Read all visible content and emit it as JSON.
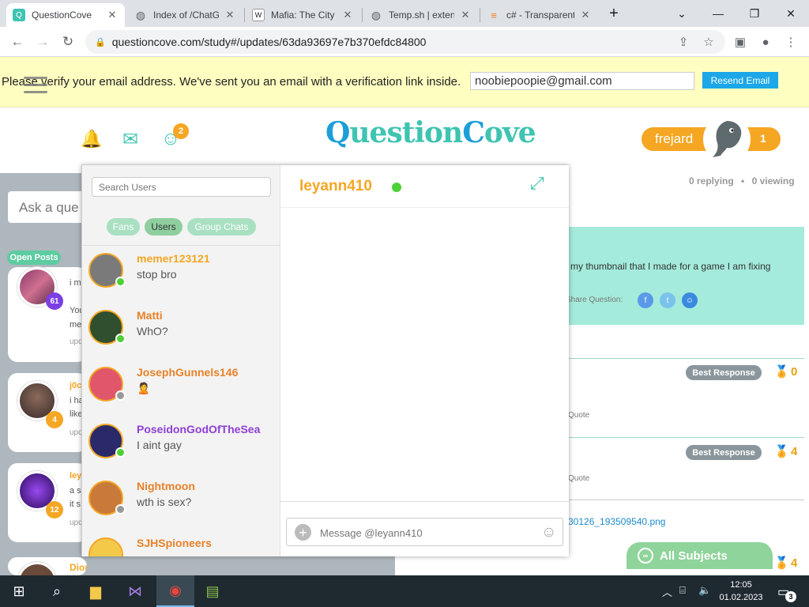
{
  "browser": {
    "tabs": [
      {
        "title": "QuestionCove",
        "active": true,
        "fav_color": "#3ec4b1",
        "fav_icon": "qc-icon"
      },
      {
        "title": "Index of /ChatG",
        "active": false,
        "fav_color": "#5f6368",
        "fav_icon": "globe-icon"
      },
      {
        "title": "Mafia: The City",
        "active": false,
        "fav_color": "#202124",
        "fav_icon": "wikipedia-icon"
      },
      {
        "title": "Temp.sh | exten",
        "active": false,
        "fav_color": "#5f6368",
        "fav_icon": "globe-icon"
      },
      {
        "title": "c# - Transparent",
        "active": false,
        "fav_color": "#f48024",
        "fav_icon": "stackoverflow-icon"
      }
    ],
    "url": "questioncove.com/study#/updates/63da93697e7b370efdc84800"
  },
  "verify_banner": {
    "message": "Please verify your email address. We've sent you an email with a verification link inside.",
    "email_value": "noobiepoopie@gmail.com",
    "resend_label": "Resend Email"
  },
  "header": {
    "logo_text_q": "Q",
    "logo_text_1": "uestion",
    "logo_text_c": "C",
    "logo_text_2": "ove",
    "notif_badge": "2",
    "username": "frejard",
    "user_level": "1"
  },
  "feed": {
    "ask_placeholder": "Ask a que",
    "open_posts": "Open Posts",
    "cards": [
      {
        "count": "61",
        "lines": [
          "i m",
          "You",
          "me",
          "upd"
        ],
        "count_color": "#7b3fe4"
      },
      {
        "count": "4",
        "lines": [
          "j0c",
          "i ha",
          "like",
          "upd"
        ],
        "count_color": "#f5a623"
      },
      {
        "count": "12",
        "lines": [
          "ley",
          "a s",
          "it s",
          "upd"
        ],
        "count_color": "#f5a623"
      }
    ],
    "partial_name": "DiorO"
  },
  "question_panel": {
    "replying": "0 replying",
    "viewing": "0 viewing",
    "snippet": "my thumbnail that I made for a game I am fixing",
    "share_label": "Share Question:",
    "responses": [
      {
        "best_label": "Best Response",
        "medals": "0",
        "quote": "Quote"
      },
      {
        "best_label": "Best Response",
        "medals": "4",
        "quote": "Quote"
      }
    ],
    "attachment": "30126_193509540.png",
    "bottom_medals": "4",
    "all_subjects": "All Subjects"
  },
  "chat": {
    "search_placeholder": "Search Users",
    "tabs": [
      "Fans",
      "Users",
      "Group Chats"
    ],
    "users": [
      {
        "name": "memer123121",
        "last": "stop bro",
        "name_color": "#f5a623",
        "status": "#4cd137",
        "av_color": "#7a7a7a"
      },
      {
        "name": "Matti",
        "last": "WhO?",
        "name_color": "#e8822a",
        "status": "#4cd137",
        "av_color": "#2f4f2f"
      },
      {
        "name": "JosephGunnels146",
        "last": "🙎",
        "name_color": "#e8822a",
        "status": "#999999",
        "av_color": "#e0566a"
      },
      {
        "name": "PoseidonGodOfTheSea",
        "last": "I aint gay",
        "name_color": "#8e3fd6",
        "status": "#4cd137",
        "av_color": "#2a2a6a"
      },
      {
        "name": "Nightmoon",
        "last": "wth is sex?",
        "name_color": "#e8822a",
        "status": "#999999",
        "av_color": "#c97a3a"
      },
      {
        "name": "SJHSpioneers",
        "last": "",
        "name_color": "#e8822a",
        "status": "#999999",
        "av_color": "#f3c94a"
      }
    ],
    "active_user": "leyann410",
    "message_placeholder": "Message @leyann410"
  },
  "taskbar": {
    "time": "12:05",
    "date": "01.02.2023",
    "notifications": "3"
  }
}
